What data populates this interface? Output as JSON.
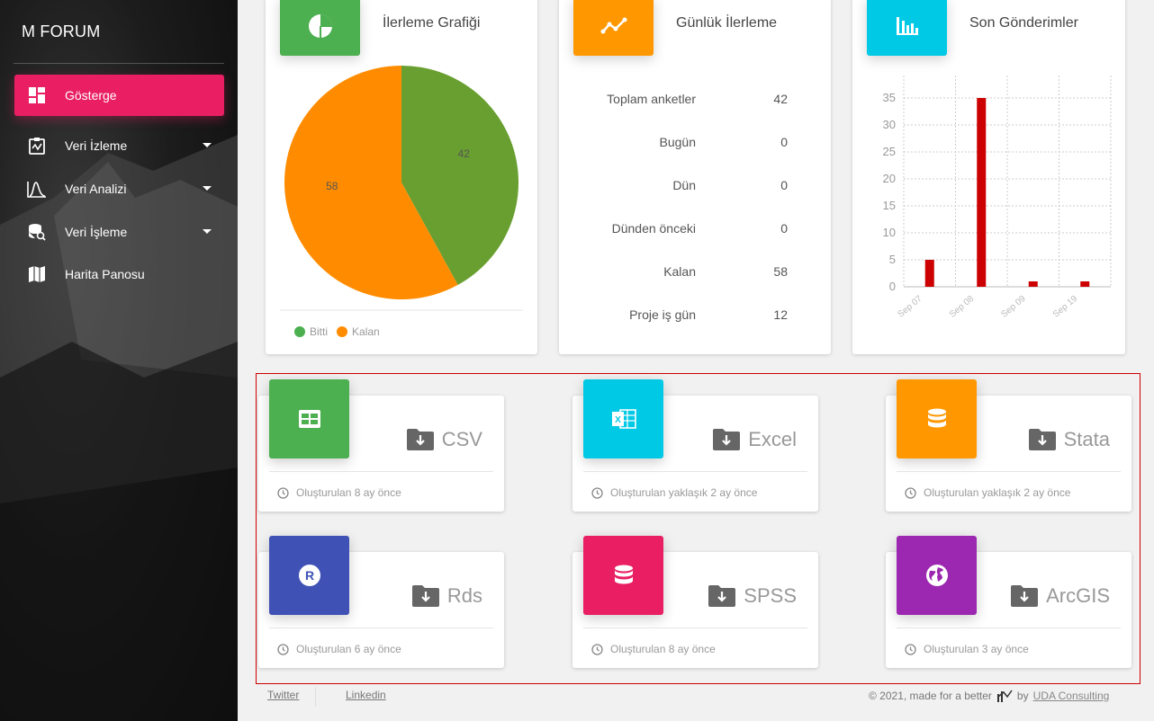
{
  "sidebar": {
    "brand": "M FORUM",
    "items": [
      {
        "label": "Gösterge",
        "icon": "dashboard-icon",
        "active": true
      },
      {
        "label": "Veri İzleme",
        "icon": "monitor-clipboard-icon",
        "caret": true
      },
      {
        "label": "Veri Analizi",
        "icon": "analysis-curve-icon",
        "caret": true
      },
      {
        "label": "Veri İşleme",
        "icon": "database-search-icon",
        "caret": true
      },
      {
        "label": "Harita Panosu",
        "icon": "map-icon"
      }
    ]
  },
  "progress_card": {
    "title": "İlerleme Grafiği",
    "icon": "pie-chart-icon",
    "color": "#4caf50",
    "legend": [
      {
        "label": "Bitti",
        "color": "#4caf50"
      },
      {
        "label": "Kalan",
        "color": "#ff8c00"
      }
    ]
  },
  "daily_card": {
    "title": "Günlük İlerleme",
    "icon": "timeline-icon",
    "color": "#ff9800",
    "rows": [
      {
        "label": "Toplam anketler",
        "value": "42"
      },
      {
        "label": "Bugün",
        "value": "0"
      },
      {
        "label": "Dün",
        "value": "0"
      },
      {
        "label": "Dünden önceki",
        "value": "0"
      },
      {
        "label": "Kalan",
        "value": "58"
      },
      {
        "label": "Proje iş gün",
        "value": "12"
      }
    ]
  },
  "submissions_card": {
    "title": "Son Gönderimler",
    "icon": "bar-chart-icon",
    "color": "#00c9e6"
  },
  "chart_data": [
    {
      "type": "pie",
      "categories": [
        "Bitti",
        "Kalan"
      ],
      "values": [
        42,
        58
      ],
      "colors": [
        "#699f30",
        "#ff8c00"
      ],
      "legend": "bottom-left"
    },
    {
      "type": "bar",
      "categories": [
        "Sep 07",
        "Sep 08",
        "Sep 09",
        "Sep 19"
      ],
      "values": [
        5,
        35,
        1,
        1
      ],
      "ylim": [
        0,
        35
      ],
      "yticks": [
        0,
        5,
        10,
        15,
        20,
        25,
        30,
        35
      ],
      "grid": true,
      "color": "#cc0000"
    }
  ],
  "downloads": [
    {
      "label": "CSV",
      "icon": "table-icon",
      "color": "#4caf50",
      "footer": "Oluşturulan 8 ay önce"
    },
    {
      "label": "Excel",
      "icon": "excel-icon",
      "color": "#00c9e6",
      "footer": "Oluşturulan yaklaşık 2 ay önce"
    },
    {
      "label": "Stata",
      "icon": "database-icon",
      "color": "#ff9800",
      "footer": "Oluşturulan yaklaşık 2 ay önce"
    },
    {
      "label": "Rds",
      "icon": "r-language-icon",
      "color": "#3f51b5",
      "footer": "Oluşturulan 6 ay önce"
    },
    {
      "label": "SPSS",
      "icon": "database-icon",
      "color": "#e91e63",
      "footer": "Oluşturulan 8 ay önce"
    },
    {
      "label": "ArcGIS",
      "icon": "globe-icon",
      "color": "#9c27b0",
      "footer": "Oluşturulan 3 ay önce"
    }
  ],
  "footer": {
    "twitter": "Twitter",
    "linkedin": "Linkedin",
    "copyright": "© 2021, made for a better",
    "by": "by",
    "company": "UDA Consulting"
  }
}
